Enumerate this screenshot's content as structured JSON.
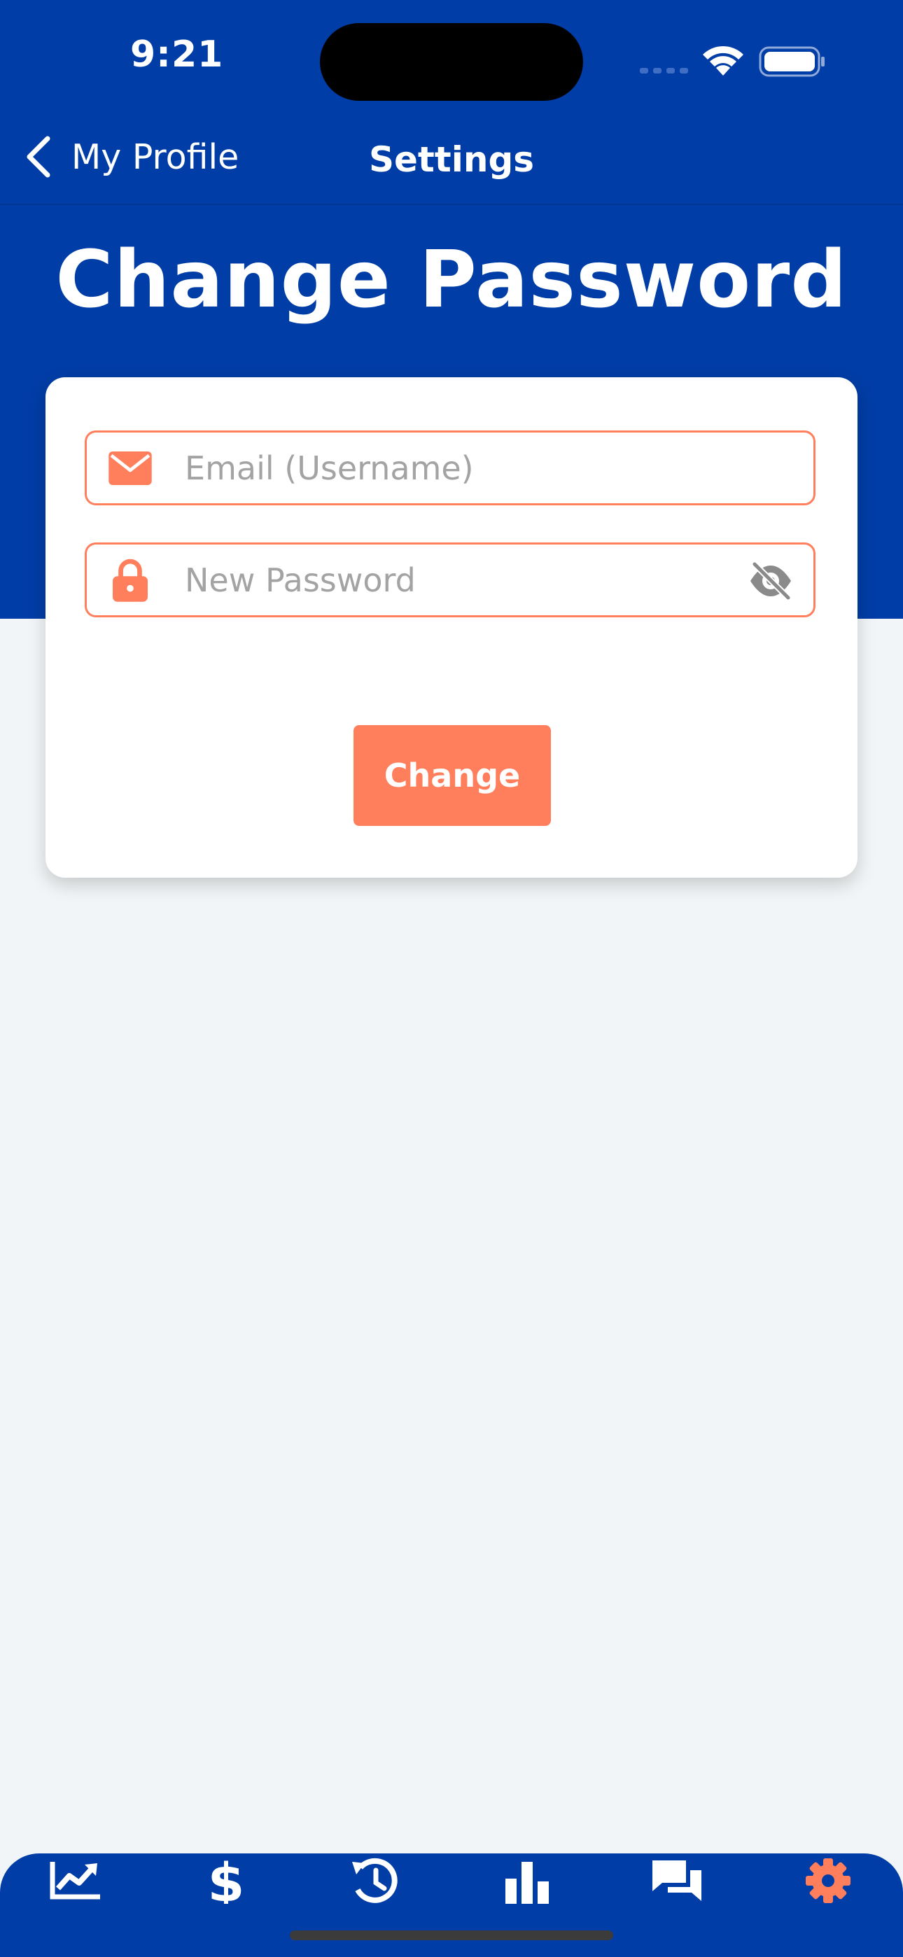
{
  "status_bar": {
    "time": "9:21"
  },
  "nav": {
    "back_label": "My Profile",
    "title": "Settings"
  },
  "page": {
    "title": "Change Password"
  },
  "form": {
    "email_placeholder": "Email (Username)",
    "email_value": "",
    "password_placeholder": "New Password",
    "password_value": "",
    "submit_label": "Change"
  },
  "tabbar": {
    "items": [
      {
        "icon": "trending-chart-icon",
        "active": false
      },
      {
        "icon": "dollar-icon",
        "active": false
      },
      {
        "icon": "history-icon",
        "active": false
      },
      {
        "icon": "bar-chart-icon",
        "active": false
      },
      {
        "icon": "chat-icon",
        "active": false
      },
      {
        "icon": "gear-icon",
        "active": true
      }
    ]
  },
  "colors": {
    "primary": "#003da6",
    "accent": "#ff7f5c",
    "background": "#f2f5f7",
    "card": "#ffffff",
    "placeholder": "#a3a3a3"
  }
}
